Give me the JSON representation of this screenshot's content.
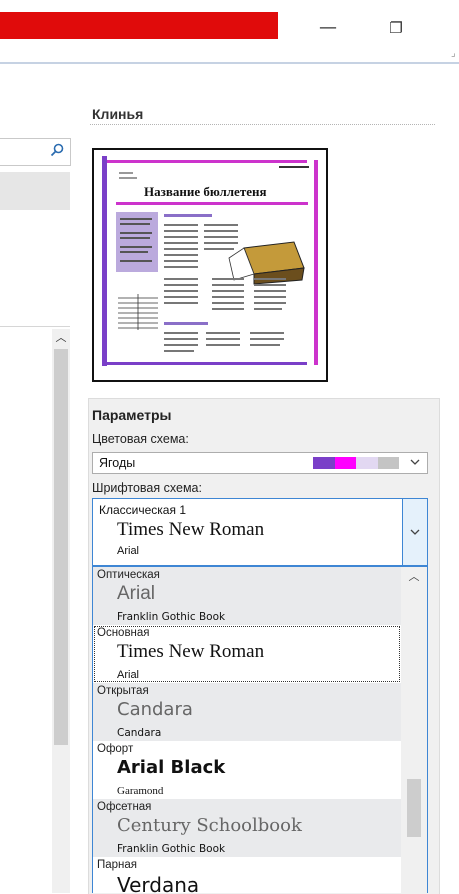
{
  "window": {
    "titlebar_color": "#e00b0b",
    "minimize_glyph": "—",
    "maximize_glyph": "❐"
  },
  "right_pane": {
    "title": "Клинья",
    "thumbnail": {
      "newsletter_title": "Название бюллетеня",
      "accent_color": "#cc33cc",
      "sidebar_color": "#bbaadd"
    },
    "params_title": "Параметры",
    "color_scheme_label": "Цветовая схема:",
    "color_scheme_value": "Ягоды",
    "color_scheme_swatches": [
      "#7a3fc8",
      "#ff00ff",
      "#e2d8f2",
      "#c4c4c4"
    ],
    "font_scheme_label": "Шрифтовая схема:",
    "font_scheme_selected": {
      "name": "Классическая 1",
      "heading": "Times New Roman",
      "body": "Arial"
    }
  },
  "font_schemes": [
    {
      "name": "Оптическая",
      "heading": "Arial",
      "body": "Franklin Gothic Book"
    },
    {
      "name": "Основная",
      "heading": "Times New Roman",
      "body": "Arial"
    },
    {
      "name": "Открытая",
      "heading": "Candara",
      "body": "Candara"
    },
    {
      "name": "Офорт",
      "heading": "Arial Black",
      "body": "Garamond"
    },
    {
      "name": "Офсетная",
      "heading": "Century Schoolbook",
      "body": "Franklin Gothic Book"
    },
    {
      "name": "Парная",
      "heading": "Verdana",
      "body": ""
    }
  ],
  "icons": {
    "search": "search-icon",
    "chevron": "chevron-down-icon",
    "scroll_up": "▲"
  }
}
